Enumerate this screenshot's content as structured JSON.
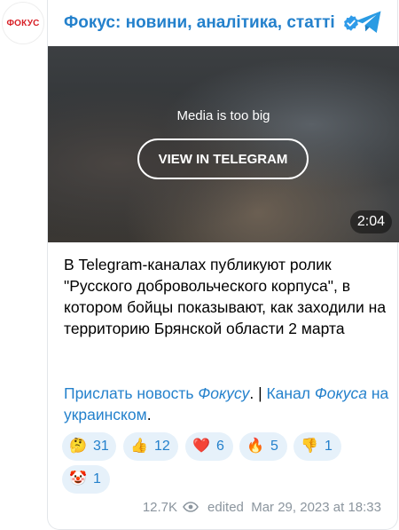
{
  "channel": {
    "avatar_text": "ФОКУС",
    "name": "Фокус: новини, аналітика, статті",
    "verified_icon": "verified-badge-icon",
    "telegram_icon": "telegram-icon"
  },
  "media": {
    "note": "Media is too big",
    "button_label": "VIEW IN TELEGRAM",
    "duration": "2:04"
  },
  "post": {
    "text": "В Telegram-каналах публикуют ролик \"Русского добровольческого корпуса\", в котором бойцы показывают, как заходили на территорию Брянской области 2 марта",
    "links": {
      "link1_part1": "Прислать новость ",
      "link1_part2": "Фокусу",
      "separator": ". | ",
      "link2_part1": "Канал ",
      "link2_part2": "Фокуса",
      "link2_part3": " на украинском",
      "end": "."
    }
  },
  "reactions": [
    {
      "emoji": "🤔",
      "count": "31"
    },
    {
      "emoji": "👍",
      "count": "12"
    },
    {
      "emoji": "❤️",
      "count": "6"
    },
    {
      "emoji": "🔥",
      "count": "5"
    },
    {
      "emoji": "👎",
      "count": "1"
    },
    {
      "emoji": "🤡",
      "count": "1"
    }
  ],
  "footer": {
    "views": "12.7K",
    "views_icon": "eye-icon",
    "edited": "edited  Mar 29, 2023 at 18:33"
  },
  "colors": {
    "accent": "#2481cc",
    "reaction_bg": "#e6f1fa",
    "muted": "#8b959e"
  }
}
